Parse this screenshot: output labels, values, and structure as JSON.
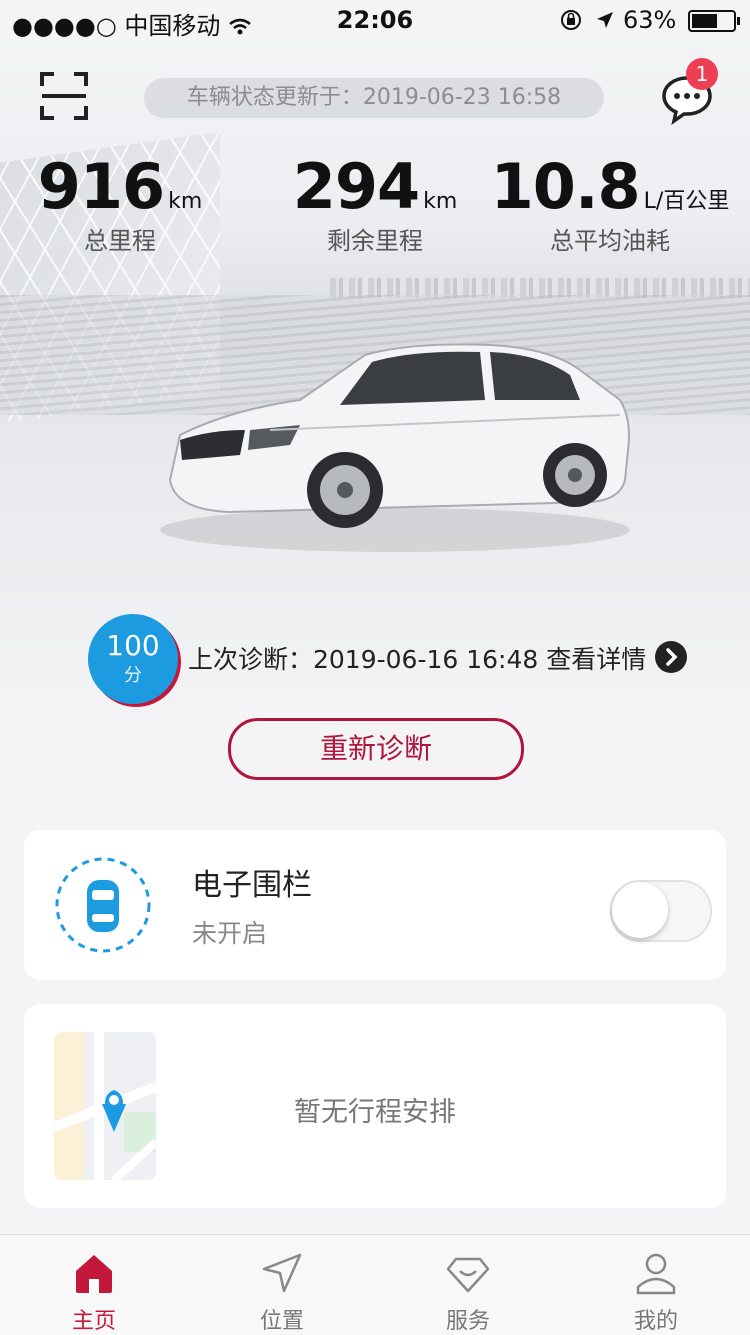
{
  "status_bar": {
    "signal": "●●●●○",
    "carrier": "中国移动",
    "time": "22:06",
    "battery_text": "63%",
    "battery_level": 0.63
  },
  "header": {
    "update_text": "车辆状态更新于：2019-06-23 16:58",
    "message_badge": "1"
  },
  "stats": [
    {
      "value": "916",
      "unit": "km",
      "label": "总里程"
    },
    {
      "value": "294",
      "unit": "km",
      "label": "剩余里程"
    },
    {
      "value": "10.8",
      "unit": "L/百公里",
      "label": "总平均油耗"
    }
  ],
  "diagnosis": {
    "score": "100",
    "score_unit": "分",
    "text": "上次诊断：2019-06-16 16:48 查看详情",
    "rediagnose_label": "重新诊断"
  },
  "fence": {
    "title": "电子围栏",
    "status": "未开启",
    "enabled": false
  },
  "trip": {
    "empty_text": "暂无行程安排"
  },
  "tabs": [
    {
      "label": "主页",
      "icon": "home-icon",
      "active": true
    },
    {
      "label": "位置",
      "icon": "navigation-icon",
      "active": false
    },
    {
      "label": "服务",
      "icon": "service-icon",
      "active": false
    },
    {
      "label": "我的",
      "icon": "profile-icon",
      "active": false
    }
  ],
  "colors": {
    "accent": "#c3183b",
    "blue": "#1c9be0",
    "badge": "#ee3e54"
  }
}
